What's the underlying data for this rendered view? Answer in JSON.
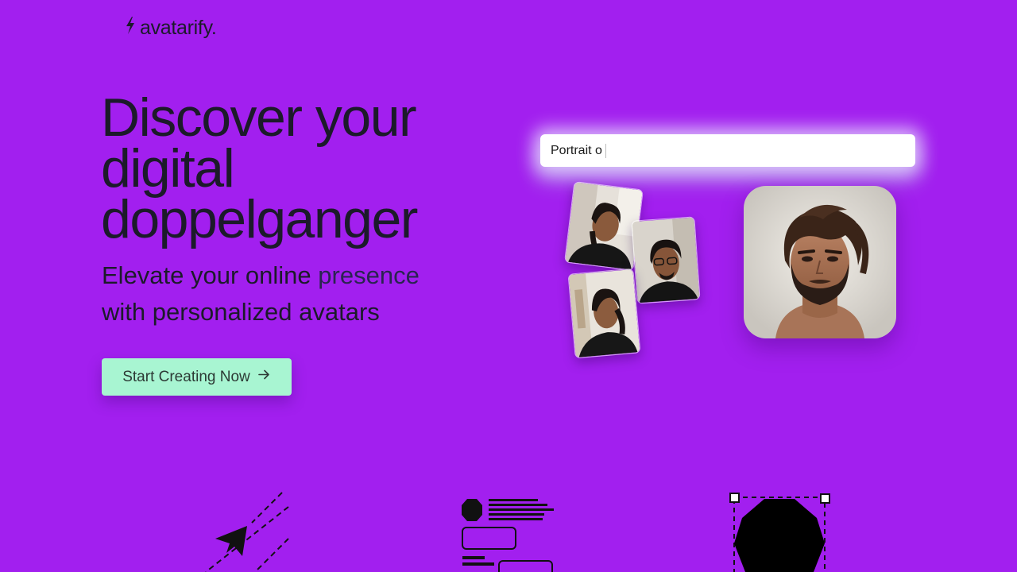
{
  "brand": {
    "name": "avatarify.",
    "icon": "lightning-icon"
  },
  "hero": {
    "title": "Discover your digital doppelganger",
    "subtitle_part1": "Elevate your online",
    "subtitle_part2": "presence",
    "subtitle_part3": "with personalized avatars",
    "cta_label": "Start Creating Now",
    "cta_icon": "arrow-right-icon"
  },
  "demo": {
    "prompt_value": "Portrait o",
    "input_photos": [
      "selfie-photo",
      "selfie-photo",
      "selfie-photo"
    ],
    "output": "generated-avatar-portrait"
  },
  "features": {
    "icons": [
      "paper-plane-icon",
      "layout-blocks-icon",
      "shape-select-icon"
    ]
  },
  "colors": {
    "background": "#a21fef",
    "cta": "#a8f5d2",
    "text": "#1c1a2a"
  }
}
